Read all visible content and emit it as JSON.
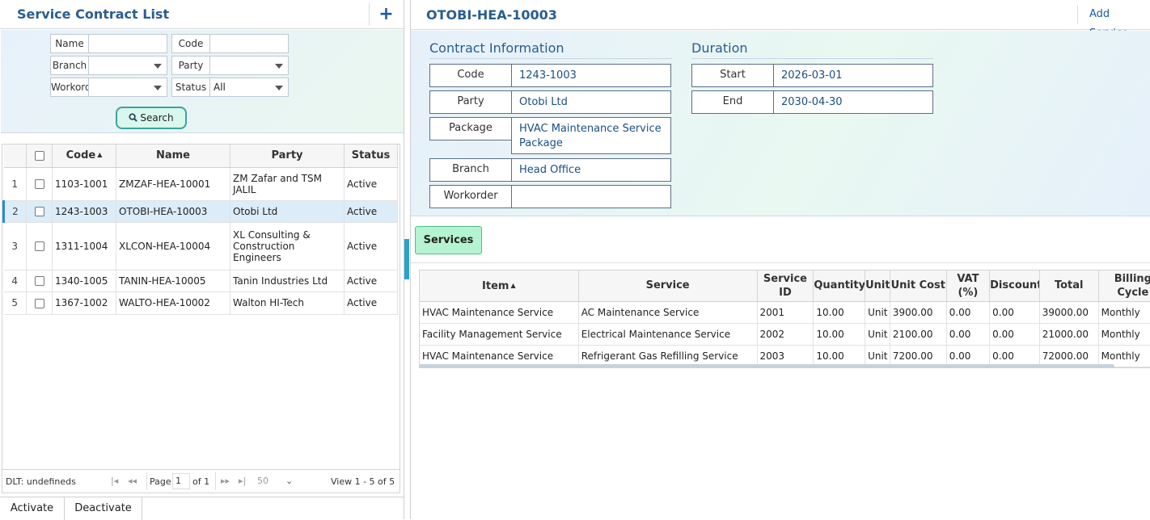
{
  "left": {
    "title": "Service Contract List",
    "add_icon": "plus-icon",
    "filters": {
      "name_label": "Name",
      "code_label": "Code",
      "branch_label": "Branch",
      "party_label": "Party",
      "workorder_label": "Workorder",
      "status_label": "Status",
      "status_value": "All",
      "name_value": "",
      "code_value": "",
      "branch_value": "",
      "party_value": "",
      "workorder_value": ""
    },
    "search_label": "Search",
    "grid": {
      "headers": [
        "",
        "",
        "Code",
        "Name",
        "Party",
        "Status"
      ],
      "rows": [
        {
          "num": "1",
          "code": "1103-1001",
          "name": "ZMZAF-HEA-10001",
          "party": "ZM Zafar and TSM JALIL",
          "status": "Active"
        },
        {
          "num": "2",
          "code": "1243-1003",
          "name": "OTOBI-HEA-10003",
          "party": "Otobi Ltd",
          "status": "Active"
        },
        {
          "num": "3",
          "code": "1311-1004",
          "name": "XLCON-HEA-10004",
          "party": "XL Consulting & Construction Engineers",
          "status": "Active"
        },
        {
          "num": "4",
          "code": "1340-1005",
          "name": "TANIN-HEA-10005",
          "party": "Tanin Industries Ltd",
          "status": "Active"
        },
        {
          "num": "5",
          "code": "1367-1002",
          "name": "WALTO-HEA-10002",
          "party": "Walton HI-Tech",
          "status": "Active"
        }
      ]
    },
    "pager": {
      "dlt": "DLT: undefineds",
      "page_label": "Page",
      "page_value": "1",
      "of": "of 1",
      "rows": "50",
      "view": "View 1 - 5 of 5"
    },
    "bottom_tabs": [
      "Activate",
      "Deactivate"
    ]
  },
  "right": {
    "title": "OTOBI-HEA-10003",
    "add_service": "Add Service",
    "contract_info_title": "Contract Information",
    "duration_title": "Duration",
    "code_label": "Code",
    "code_value": "1243-1003",
    "party_label": "Party",
    "party_value": "Otobi Ltd",
    "package_label": "Package",
    "package_value": "HVAC Maintenance Service Package",
    "branch_label": "Branch",
    "branch_value": "Head Office",
    "workorder_label": "Workorder",
    "workorder_value": "",
    "start_label": "Start",
    "start_value": "2026-03-01",
    "end_label": "End",
    "end_value": "2030-04-30",
    "services_btn": "Services",
    "services": {
      "headers": [
        "Item",
        "Service",
        "Service ID",
        "Quantity",
        "Unit",
        "Unit Cost",
        "VAT (%)",
        "Discount",
        "Total",
        "Billing Cycle"
      ],
      "rows": [
        [
          "HVAC Maintenance Service",
          "AC Maintenance Service",
          "2001",
          "10.00",
          "Unit",
          "3900.00",
          "0.00",
          "0.00",
          "39000.00",
          "Monthly"
        ],
        [
          "Facility Management Service",
          "Electrical Maintenance Service",
          "2002",
          "10.00",
          "Unit",
          "2100.00",
          "0.00",
          "0.00",
          "21000.00",
          "Monthly"
        ],
        [
          "HVAC Maintenance Service",
          "Refrigerant Gas Refilling Service",
          "2003",
          "10.00",
          "Unit",
          "7200.00",
          "0.00",
          "0.00",
          "72000.00",
          "Monthly"
        ]
      ]
    }
  }
}
